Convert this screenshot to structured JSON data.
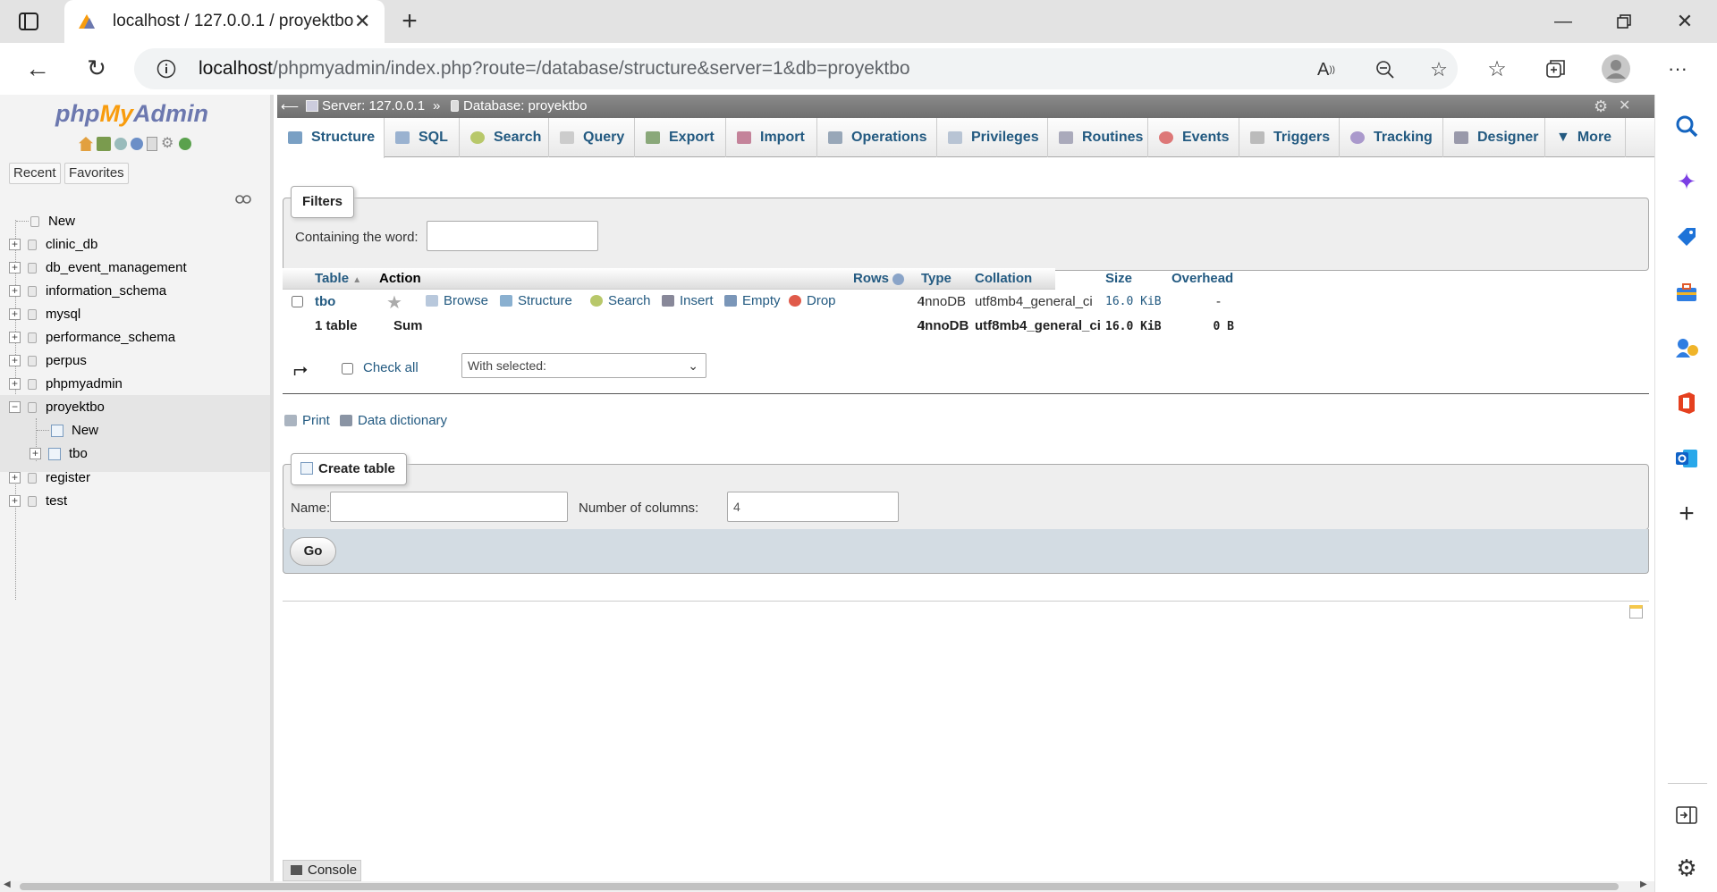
{
  "browser": {
    "tab_title": "localhost / 127.0.0.1 / proyektbo",
    "url_host": "localhost",
    "url_path": "/phpmyadmin/index.php?route=/database/structure&server=1&db=proyektbo"
  },
  "pma_nav": {
    "logo_php": "php",
    "logo_my": "My",
    "logo_admin": "Admin",
    "recent": "Recent",
    "favorites": "Favorites",
    "tree": {
      "new_top": "New",
      "databases": [
        "clinic_db",
        "db_event_management",
        "information_schema",
        "mysql",
        "performance_schema",
        "perpus",
        "phpmyadmin",
        "proyektbo"
      ],
      "proyektbo_new": "New",
      "proyektbo_table": "tbo",
      "after": [
        "register",
        "test"
      ]
    }
  },
  "breadcrumb": {
    "server": "Server: 127.0.0.1",
    "sep": "»",
    "database": "Database: proyektbo"
  },
  "menu_tabs": [
    "Structure",
    "SQL",
    "Search",
    "Query",
    "Export",
    "Import",
    "Operations",
    "Privileges",
    "Routines",
    "Events",
    "Triggers",
    "Tracking",
    "Designer",
    "More"
  ],
  "filters": {
    "legend": "Filters",
    "label": "Containing the word:",
    "value": ""
  },
  "table": {
    "headers": {
      "table": "Table",
      "action": "Action",
      "rows": "Rows",
      "type": "Type",
      "collation": "Collation",
      "size": "Size",
      "overhead": "Overhead"
    },
    "row": {
      "name": "tbo",
      "actions": [
        "Browse",
        "Structure",
        "Search",
        "Insert",
        "Empty",
        "Drop"
      ],
      "rows": "4",
      "type": "InnoDB",
      "collation": "utf8mb4_general_ci",
      "size": "16.0 KiB",
      "overhead": "-"
    },
    "summary": {
      "count": "1 table",
      "sum": "Sum",
      "rows": "4",
      "type": "InnoDB",
      "collation": "utf8mb4_general_ci",
      "size": "16.0 KiB",
      "overhead": "0 B"
    },
    "check_all": "Check all",
    "with_selected": "With selected:"
  },
  "links": {
    "print": "Print",
    "data_dictionary": "Data dictionary"
  },
  "create_table": {
    "legend": "Create table",
    "name_label": "Name:",
    "name_value": "",
    "columns_label": "Number of columns:",
    "columns_value": "4",
    "go": "Go"
  },
  "console": "Console"
}
